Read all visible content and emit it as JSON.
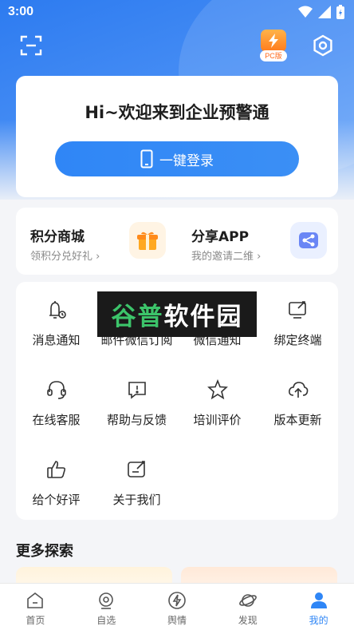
{
  "status_bar": {
    "time": "3:00"
  },
  "header": {
    "pc_badge": "PC版"
  },
  "welcome": {
    "title": "Hi~欢迎来到企业预警通",
    "login_label": "一键登录"
  },
  "promo": [
    {
      "title": "积分商城",
      "subtitle": "领积分兑好礼",
      "icon": "gift-icon"
    },
    {
      "title": "分享APP",
      "subtitle": "我的邀请二维",
      "icon": "share-icon"
    }
  ],
  "menu": [
    {
      "label": "消息通知",
      "icon": "bell-icon"
    },
    {
      "label": "邮件微信订阅",
      "icon": "mail-icon"
    },
    {
      "label": "微信通知",
      "icon": "wechat-icon"
    },
    {
      "label": "绑定终端",
      "icon": "device-icon"
    },
    {
      "label": "在线客服",
      "icon": "headset-icon"
    },
    {
      "label": "帮助与反馈",
      "icon": "feedback-icon"
    },
    {
      "label": "培训评价",
      "icon": "star-icon"
    },
    {
      "label": "版本更新",
      "icon": "cloud-upload-icon"
    },
    {
      "label": "给个好评",
      "icon": "thumbs-up-icon"
    },
    {
      "label": "关于我们",
      "icon": "info-icon"
    }
  ],
  "watermark": {
    "green": "谷普",
    "white": "软件园"
  },
  "more": {
    "title": "更多探索"
  },
  "tabs": [
    {
      "label": "首页",
      "icon": "home-icon"
    },
    {
      "label": "自选",
      "icon": "watch-icon"
    },
    {
      "label": "舆情",
      "icon": "lightning-icon"
    },
    {
      "label": "发现",
      "icon": "planet-icon"
    },
    {
      "label": "我的",
      "icon": "user-icon",
      "active": true
    }
  ],
  "colors": {
    "primary": "#2f86f6",
    "accent_orange": "#ff7b1c",
    "background": "#f4f5f8"
  }
}
